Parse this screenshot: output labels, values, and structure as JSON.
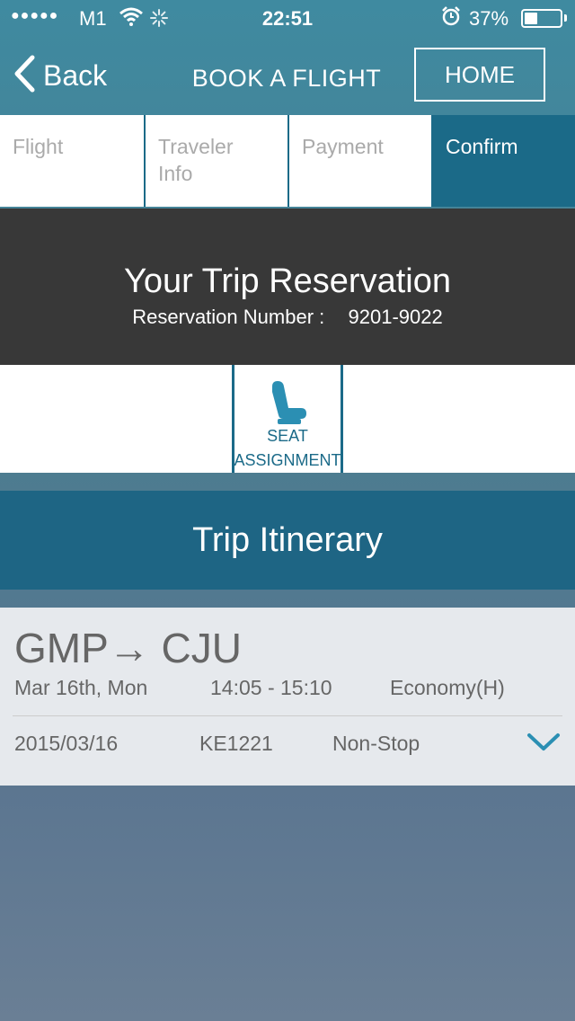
{
  "status_bar": {
    "signal": "●●●●●",
    "carrier": "M1",
    "time": "22:51",
    "battery": "37%",
    "battery_level": 0.37
  },
  "nav": {
    "back_label": "Back",
    "title": "BOOK A FLIGHT",
    "home_label": "HOME"
  },
  "steps": [
    {
      "label": "Flight",
      "active": false
    },
    {
      "label": "Traveler Info",
      "active": false
    },
    {
      "label": "Payment",
      "active": false
    },
    {
      "label": "Confirm",
      "active": true
    }
  ],
  "reservation": {
    "title": "Your Trip Reservation",
    "number_label": "Reservation Number :",
    "number": "9201-9022"
  },
  "seat_assignment": {
    "label": "SEAT ASSIGNMENT",
    "icon": "seat-icon"
  },
  "itinerary": {
    "header": "Trip Itinerary",
    "route": "GMP→ CJU",
    "date_text": "Mar 16th, Mon",
    "time": "14:05 - 15:10",
    "cabin": "Economy(H)",
    "date": "2015/03/16",
    "flight_number": "KE1221",
    "stops": "Non-Stop"
  },
  "colors": {
    "accent": "#1b6a88",
    "banner": "#383838",
    "card": "#e6e9ed"
  }
}
